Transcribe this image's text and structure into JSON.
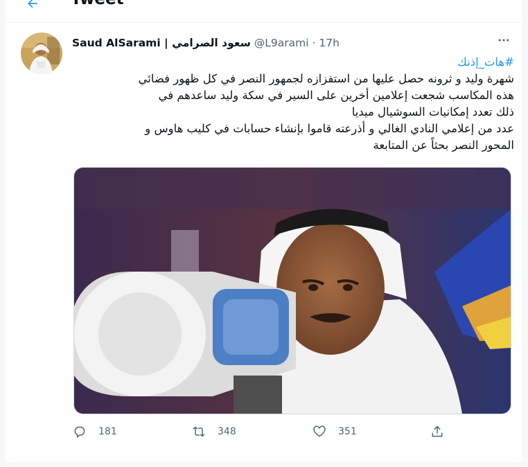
{
  "header": {
    "title": "Tweet"
  },
  "tweet": {
    "author": {
      "display_name": "Saud AlSarami | سعود الصرامي",
      "handle": "@L9arami",
      "separator": "·",
      "time": "17h"
    },
    "hashtag": "#هات_إذنك",
    "lines": [
      "شهرة وليد و ثرونه حصل عليها من استفزازه لجمهور النصر في كل ظهور فضائي",
      "هذه المكاسب شجعت إعلامين أخرين على السير في سكة وليد ساعدهم في",
      "ذلك تعدد إمكانيات السوشيال ميديا",
      "عدد من إعلامي النادي الغالي و أذرعته قاموا بإنشاء حسابات في كليب هاوس و",
      "المحور النصر بحثاً عن المتابعة"
    ],
    "stats": {
      "replies": "181",
      "retweets": "348",
      "likes": "351"
    }
  },
  "icons": {
    "back": "back-arrow-icon",
    "more": "more-dots-icon",
    "reply": "reply-icon",
    "retweet": "retweet-icon",
    "like": "heart-icon",
    "share": "share-icon"
  },
  "colors": {
    "link": "#1d9bf0",
    "secondary": "#536471",
    "text": "#0f1419",
    "border": "#eff3f4"
  }
}
